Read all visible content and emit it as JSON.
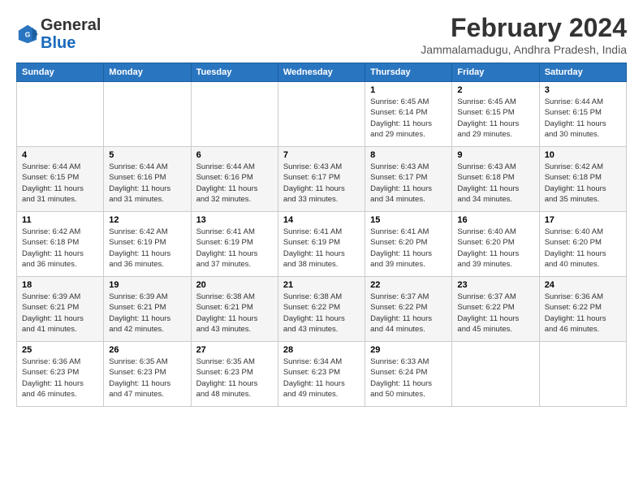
{
  "logo": {
    "text_general": "General",
    "text_blue": "Blue"
  },
  "header": {
    "title": "February 2024",
    "subtitle": "Jammalamadugu, Andhra Pradesh, India"
  },
  "weekdays": [
    "Sunday",
    "Monday",
    "Tuesday",
    "Wednesday",
    "Thursday",
    "Friday",
    "Saturday"
  ],
  "weeks": [
    [
      {
        "day": "",
        "info": ""
      },
      {
        "day": "",
        "info": ""
      },
      {
        "day": "",
        "info": ""
      },
      {
        "day": "",
        "info": ""
      },
      {
        "day": "1",
        "info": "Sunrise: 6:45 AM\nSunset: 6:14 PM\nDaylight: 11 hours and 29 minutes."
      },
      {
        "day": "2",
        "info": "Sunrise: 6:45 AM\nSunset: 6:15 PM\nDaylight: 11 hours and 29 minutes."
      },
      {
        "day": "3",
        "info": "Sunrise: 6:44 AM\nSunset: 6:15 PM\nDaylight: 11 hours and 30 minutes."
      }
    ],
    [
      {
        "day": "4",
        "info": "Sunrise: 6:44 AM\nSunset: 6:15 PM\nDaylight: 11 hours and 31 minutes."
      },
      {
        "day": "5",
        "info": "Sunrise: 6:44 AM\nSunset: 6:16 PM\nDaylight: 11 hours and 31 minutes."
      },
      {
        "day": "6",
        "info": "Sunrise: 6:44 AM\nSunset: 6:16 PM\nDaylight: 11 hours and 32 minutes."
      },
      {
        "day": "7",
        "info": "Sunrise: 6:43 AM\nSunset: 6:17 PM\nDaylight: 11 hours and 33 minutes."
      },
      {
        "day": "8",
        "info": "Sunrise: 6:43 AM\nSunset: 6:17 PM\nDaylight: 11 hours and 34 minutes."
      },
      {
        "day": "9",
        "info": "Sunrise: 6:43 AM\nSunset: 6:18 PM\nDaylight: 11 hours and 34 minutes."
      },
      {
        "day": "10",
        "info": "Sunrise: 6:42 AM\nSunset: 6:18 PM\nDaylight: 11 hours and 35 minutes."
      }
    ],
    [
      {
        "day": "11",
        "info": "Sunrise: 6:42 AM\nSunset: 6:18 PM\nDaylight: 11 hours and 36 minutes."
      },
      {
        "day": "12",
        "info": "Sunrise: 6:42 AM\nSunset: 6:19 PM\nDaylight: 11 hours and 36 minutes."
      },
      {
        "day": "13",
        "info": "Sunrise: 6:41 AM\nSunset: 6:19 PM\nDaylight: 11 hours and 37 minutes."
      },
      {
        "day": "14",
        "info": "Sunrise: 6:41 AM\nSunset: 6:19 PM\nDaylight: 11 hours and 38 minutes."
      },
      {
        "day": "15",
        "info": "Sunrise: 6:41 AM\nSunset: 6:20 PM\nDaylight: 11 hours and 39 minutes."
      },
      {
        "day": "16",
        "info": "Sunrise: 6:40 AM\nSunset: 6:20 PM\nDaylight: 11 hours and 39 minutes."
      },
      {
        "day": "17",
        "info": "Sunrise: 6:40 AM\nSunset: 6:20 PM\nDaylight: 11 hours and 40 minutes."
      }
    ],
    [
      {
        "day": "18",
        "info": "Sunrise: 6:39 AM\nSunset: 6:21 PM\nDaylight: 11 hours and 41 minutes."
      },
      {
        "day": "19",
        "info": "Sunrise: 6:39 AM\nSunset: 6:21 PM\nDaylight: 11 hours and 42 minutes."
      },
      {
        "day": "20",
        "info": "Sunrise: 6:38 AM\nSunset: 6:21 PM\nDaylight: 11 hours and 43 minutes."
      },
      {
        "day": "21",
        "info": "Sunrise: 6:38 AM\nSunset: 6:22 PM\nDaylight: 11 hours and 43 minutes."
      },
      {
        "day": "22",
        "info": "Sunrise: 6:37 AM\nSunset: 6:22 PM\nDaylight: 11 hours and 44 minutes."
      },
      {
        "day": "23",
        "info": "Sunrise: 6:37 AM\nSunset: 6:22 PM\nDaylight: 11 hours and 45 minutes."
      },
      {
        "day": "24",
        "info": "Sunrise: 6:36 AM\nSunset: 6:22 PM\nDaylight: 11 hours and 46 minutes."
      }
    ],
    [
      {
        "day": "25",
        "info": "Sunrise: 6:36 AM\nSunset: 6:23 PM\nDaylight: 11 hours and 46 minutes."
      },
      {
        "day": "26",
        "info": "Sunrise: 6:35 AM\nSunset: 6:23 PM\nDaylight: 11 hours and 47 minutes."
      },
      {
        "day": "27",
        "info": "Sunrise: 6:35 AM\nSunset: 6:23 PM\nDaylight: 11 hours and 48 minutes."
      },
      {
        "day": "28",
        "info": "Sunrise: 6:34 AM\nSunset: 6:23 PM\nDaylight: 11 hours and 49 minutes."
      },
      {
        "day": "29",
        "info": "Sunrise: 6:33 AM\nSunset: 6:24 PM\nDaylight: 11 hours and 50 minutes."
      },
      {
        "day": "",
        "info": ""
      },
      {
        "day": "",
        "info": ""
      }
    ]
  ]
}
